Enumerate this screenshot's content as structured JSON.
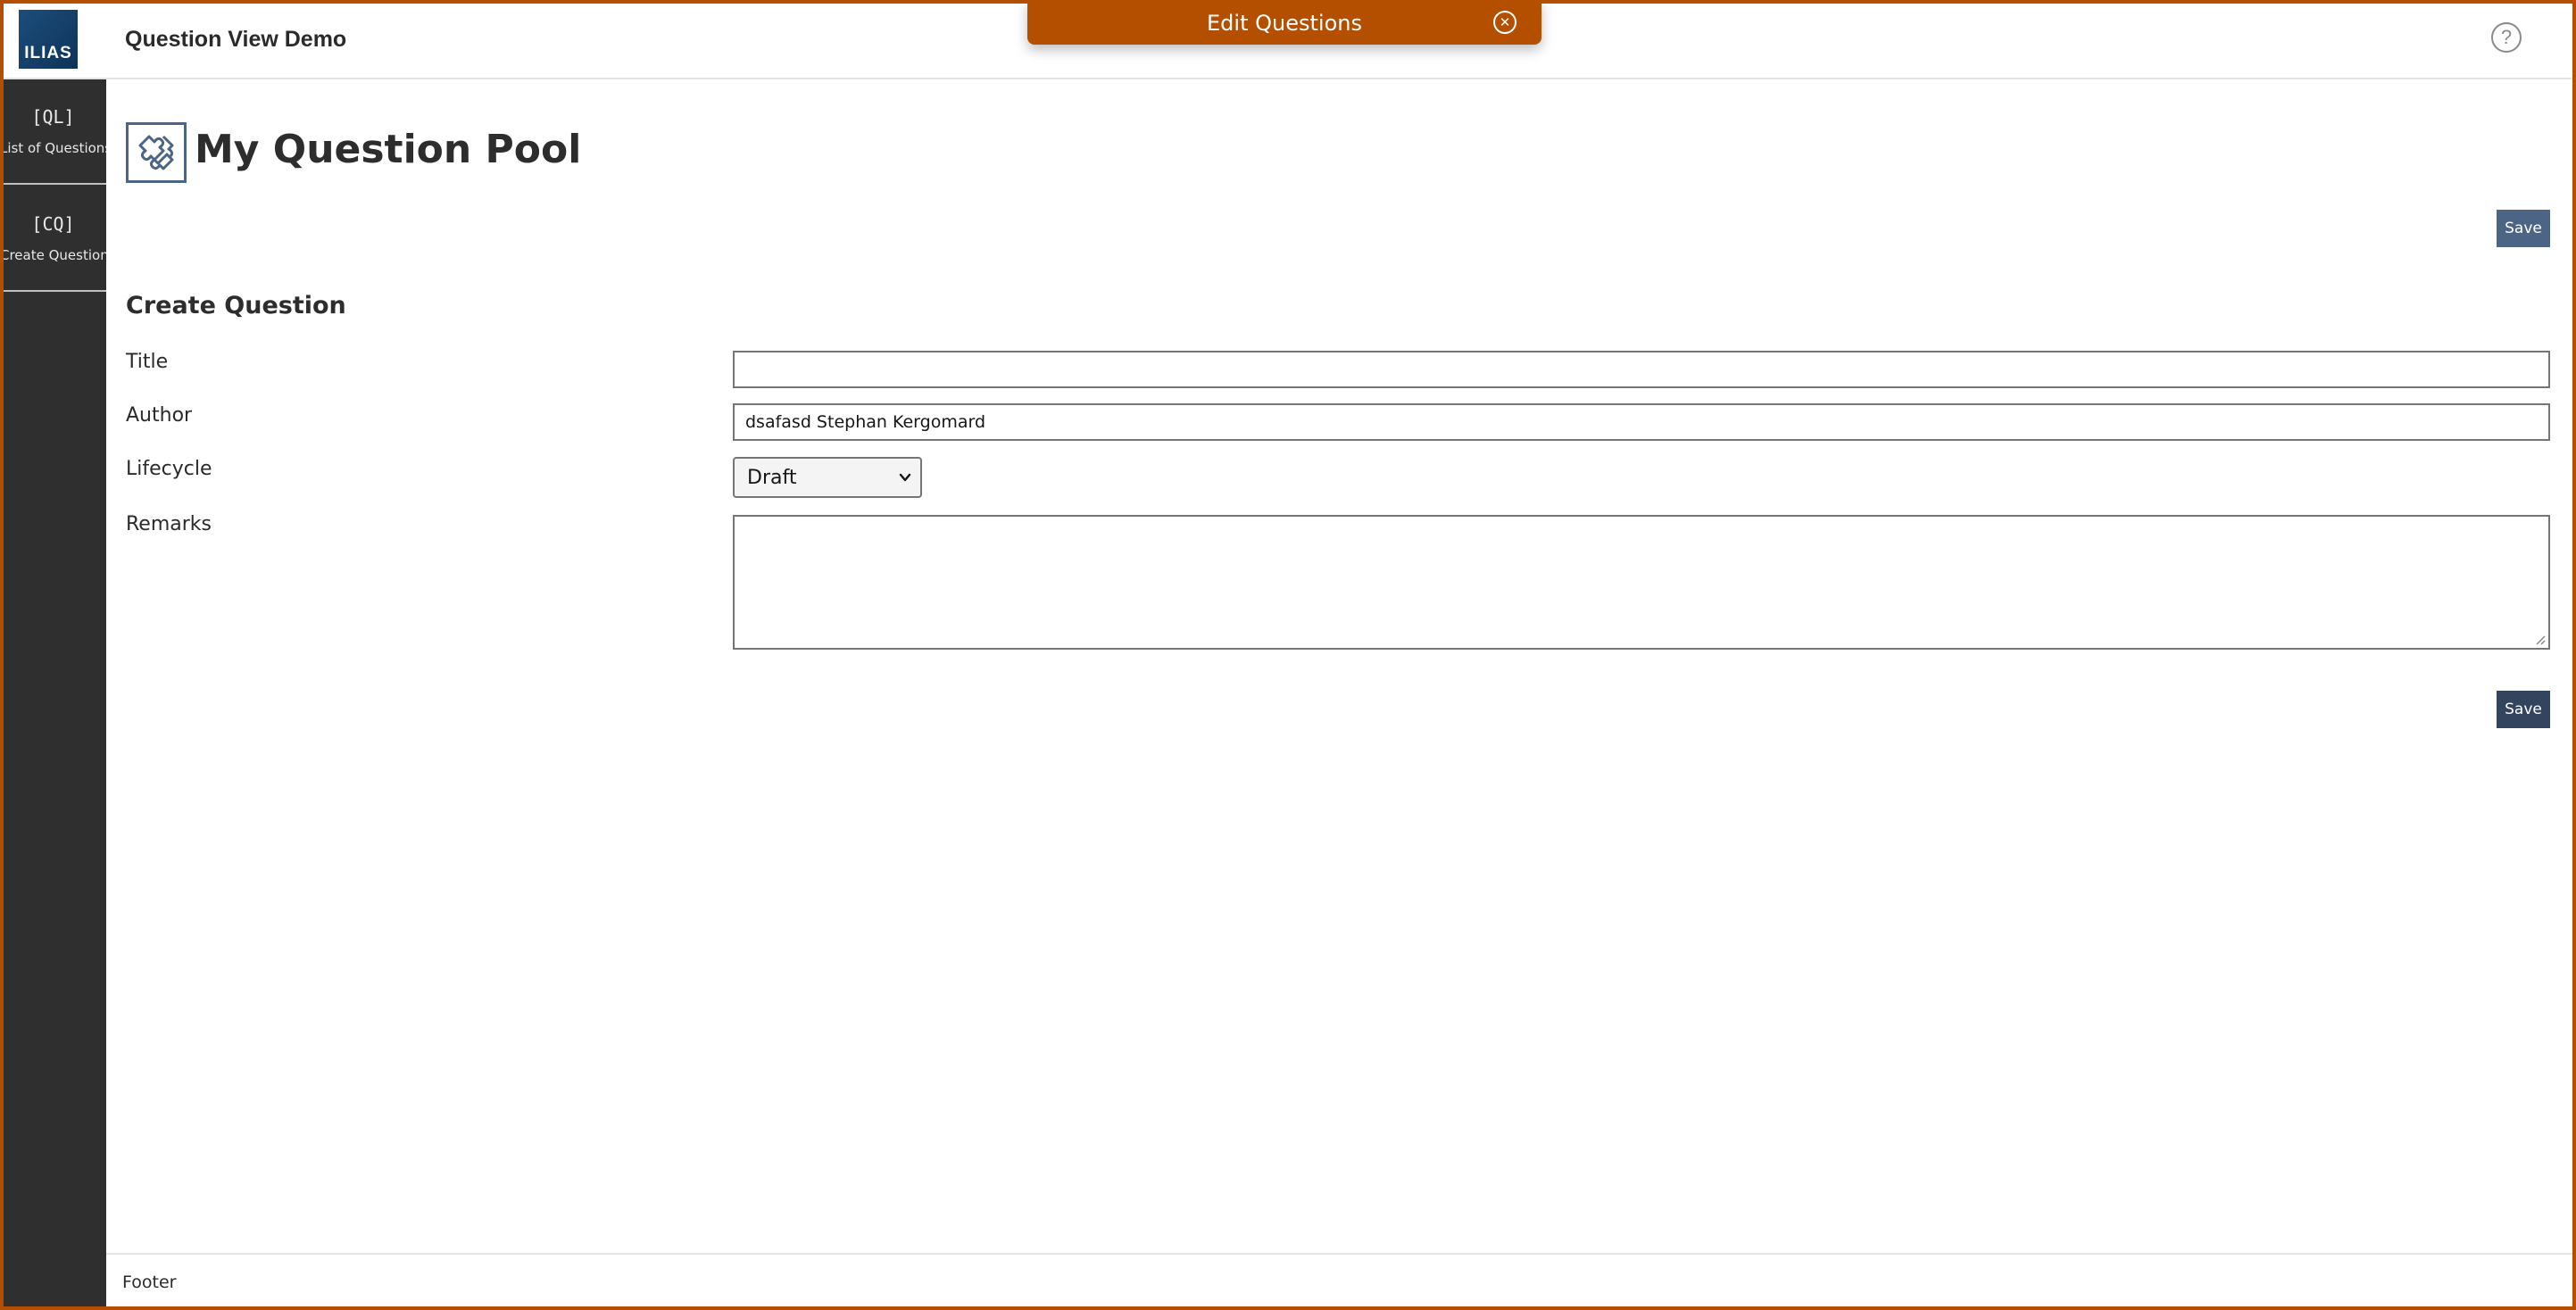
{
  "header": {
    "logo_text": "ILIAS",
    "app_title": "Question View Demo",
    "help_icon": "question-circle-icon",
    "help_symbol": "?"
  },
  "mode_banner": {
    "label": "Edit Questions",
    "close_icon": "close-circle-icon",
    "close_symbol": "✕",
    "color": "#b54f00"
  },
  "sidebar": {
    "items": [
      {
        "symbol": "[QL]",
        "label": "List of Questions"
      },
      {
        "symbol": "[CQ]",
        "label": "Create Question"
      }
    ],
    "background": "#2f2f2f"
  },
  "main": {
    "page_icon": "puzzle-piece-icon",
    "page_title": "My Question Pool",
    "save_top_label": "Save",
    "save_bottom_label": "Save",
    "button_color": "#4c6586"
  },
  "form": {
    "section_title": "Create Question",
    "fields": {
      "title": {
        "label": "Title",
        "value": ""
      },
      "author": {
        "label": "Author",
        "value": "dsafasd Stephan Kergomard"
      },
      "lifecycle": {
        "label": "Lifecycle",
        "selected": "Draft"
      },
      "remarks": {
        "label": "Remarks",
        "value": ""
      }
    }
  },
  "footer": {
    "text": "Footer"
  }
}
